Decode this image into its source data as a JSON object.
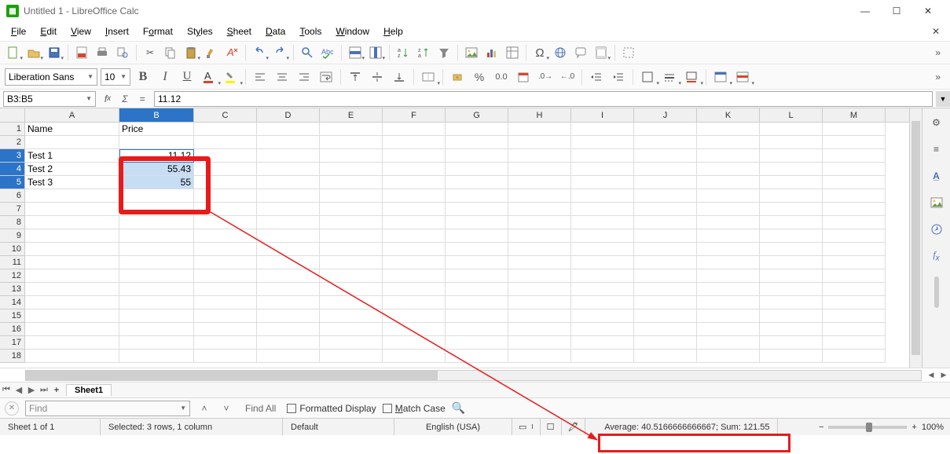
{
  "window": {
    "title": "Untitled 1 - LibreOffice Calc"
  },
  "menu": {
    "file": "File",
    "edit": "Edit",
    "view": "View",
    "insert": "Insert",
    "format": "Format",
    "styles": "Styles",
    "sheet": "Sheet",
    "data": "Data",
    "tools": "Tools",
    "window": "Window",
    "help": "Help"
  },
  "fontbar": {
    "font_name": "Liberation Sans",
    "font_size": "10"
  },
  "formulabar": {
    "name_box": "B3:B5",
    "input": "11.12"
  },
  "columns": [
    "A",
    "B",
    "C",
    "D",
    "E",
    "F",
    "G",
    "H",
    "I",
    "J",
    "K",
    "L",
    "M"
  ],
  "cells": {
    "A1": "Name",
    "B1": "Price",
    "A3": "Test 1",
    "A4": "Test 2",
    "A5": "Test 3",
    "B3": "11.12",
    "B4": "55.43",
    "B5": "55"
  },
  "tabs": {
    "sheet1": "Sheet1"
  },
  "findbar": {
    "placeholder": "Find",
    "find_all": "Find All",
    "formatted": "Formatted Display",
    "match_case": "Match Case"
  },
  "statusbar": {
    "sheet": "Sheet 1 of 1",
    "selection": "Selected: 3 rows, 1 column",
    "style": "Default",
    "lang": "English (USA)",
    "calc": "Average: 40.5166666666667; Sum: 121.55",
    "zoom_label": "100%"
  }
}
